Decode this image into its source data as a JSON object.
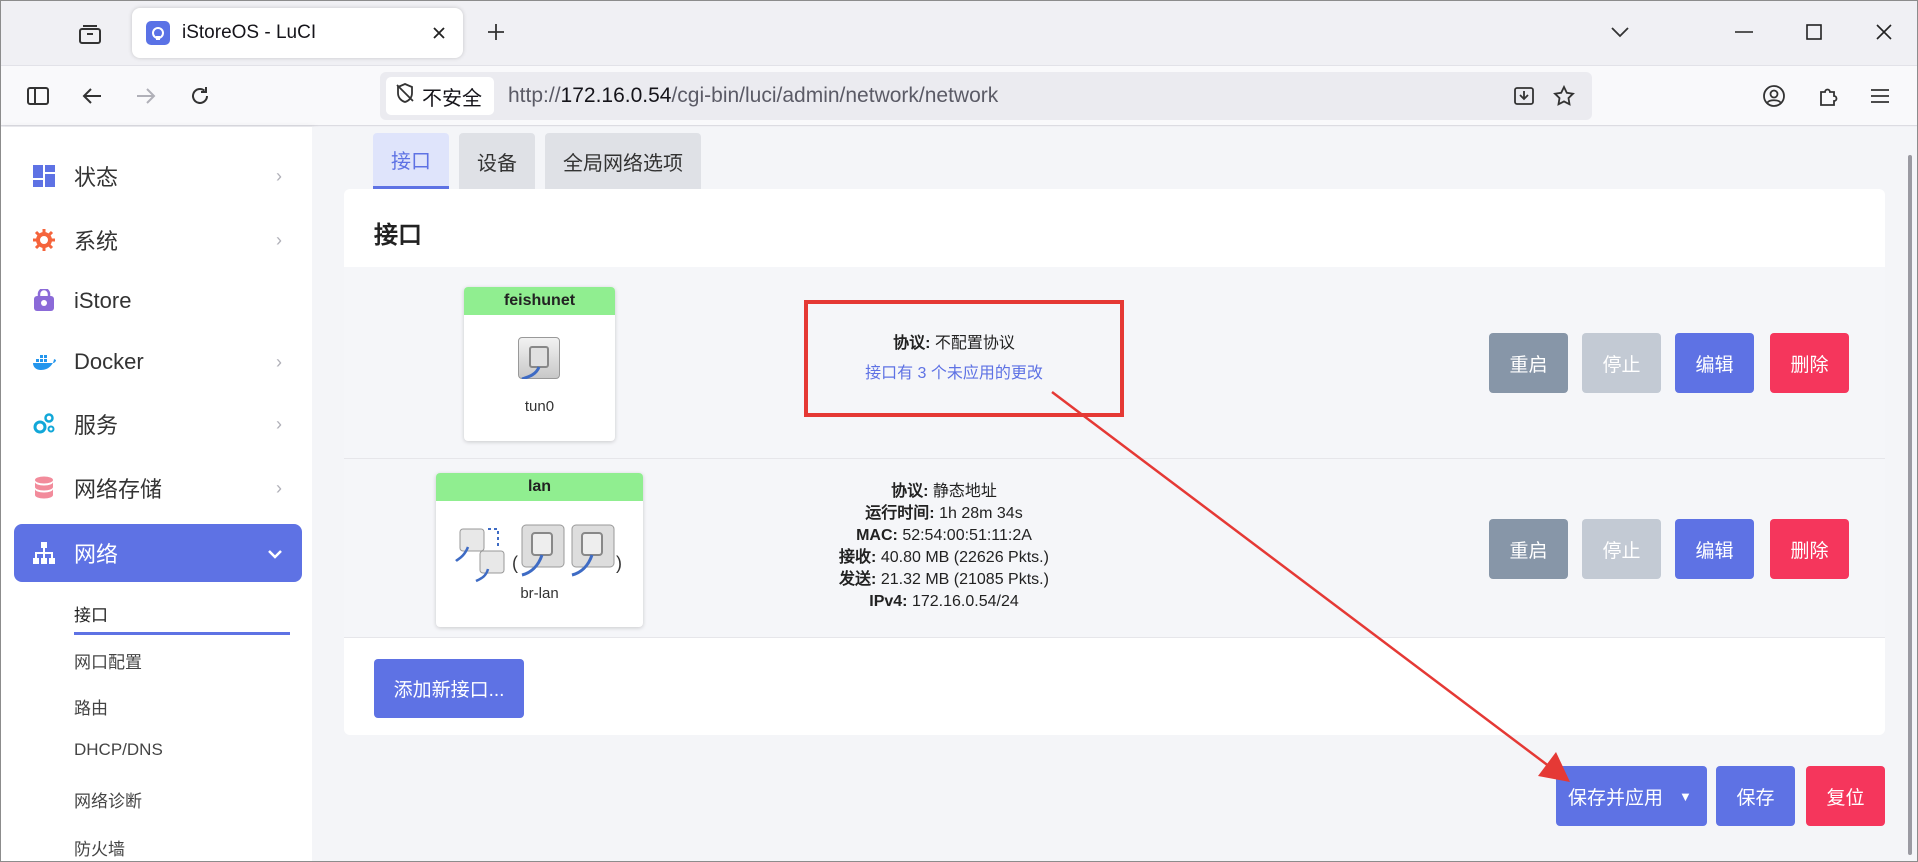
{
  "browser": {
    "tab_title": "iStoreOS - LuCI",
    "security_label": "不安全",
    "url_prefix": "http://",
    "url_host": "172.16.0.54",
    "url_path": "/cgi-bin/luci/admin/network/network"
  },
  "sidebar": {
    "items": [
      {
        "label": "状态",
        "icon": "dashboard-icon",
        "arrow": true
      },
      {
        "label": "系统",
        "icon": "gear-icon",
        "arrow": true
      },
      {
        "label": "iStore",
        "icon": "store-bag-icon",
        "arrow": false
      },
      {
        "label": "Docker",
        "icon": "docker-icon",
        "arrow": true
      },
      {
        "label": "服务",
        "icon": "services-gears-icon",
        "arrow": true
      },
      {
        "label": "网络存储",
        "icon": "database-icon",
        "arrow": true
      },
      {
        "label": "网络",
        "icon": "network-tree-icon",
        "arrow": true,
        "active": true
      }
    ],
    "submenu": [
      "接口",
      "网口配置",
      "路由",
      "DHCP/DNS",
      "网络诊断",
      "防火墙"
    ],
    "active_submenu": "接口"
  },
  "content_tabs": [
    "接口",
    "设备",
    "全局网络选项"
  ],
  "panel_title": "接口",
  "interfaces": [
    {
      "name": "feishunet",
      "device": "tun0",
      "protocol_label": "协议:",
      "protocol": "不配置协议",
      "pending": "接口有 3 个未应用的更改"
    },
    {
      "name": "lan",
      "device": "br-lan",
      "protocol_label": "协议:",
      "protocol": "静态地址",
      "uptime_label": "运行时间:",
      "uptime": "1h 28m 34s",
      "mac_label": "MAC:",
      "mac": "52:54:00:51:11:2A",
      "rx_label": "接收:",
      "rx": "40.80 MB (22626 Pkts.)",
      "tx_label": "发送:",
      "tx": "21.32 MB (21085 Pkts.)",
      "ipv4_label": "IPv4:",
      "ipv4": "172.16.0.54/24"
    }
  ],
  "row_buttons": {
    "restart": "重启",
    "stop": "停止",
    "edit": "编辑",
    "delete": "删除"
  },
  "add_interface": "添加新接口...",
  "footer": {
    "save_apply": "保存并应用",
    "save": "保存",
    "reset": "复位"
  },
  "colors": {
    "accent": "#5e72e4",
    "danger": "#f5365c",
    "restart": "#8796a8",
    "stop_disabled": "#c3cad4",
    "iface_header": "#90ee90",
    "annotation": "#e53935"
  }
}
